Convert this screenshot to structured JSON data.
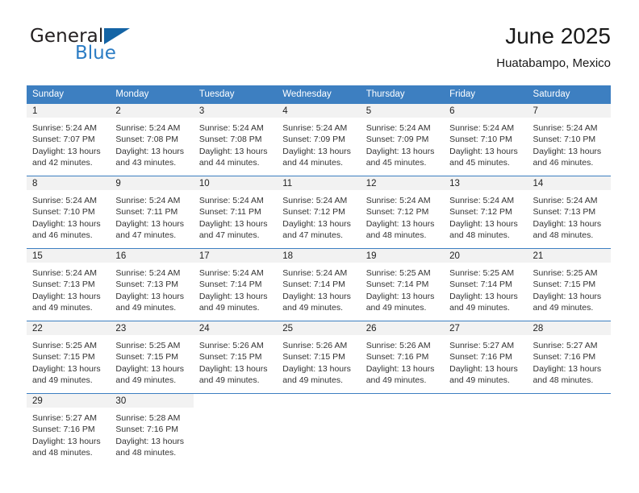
{
  "brand": {
    "name_top": "General",
    "name_bottom": "Blue",
    "flag_icon": "brand-flag-icon"
  },
  "header": {
    "title": "June 2025",
    "subtitle": "Huatabampo, Mexico"
  },
  "calendar": {
    "weekday_headers": [
      "Sunday",
      "Monday",
      "Tuesday",
      "Wednesday",
      "Thursday",
      "Friday",
      "Saturday"
    ],
    "colors": {
      "header_blue": "#3d7fc1",
      "daynum_band": "#f2f2f2",
      "brand_blue": "#2b7cc4",
      "flag_blue": "#1464a5"
    },
    "weeks": [
      [
        {
          "day": "1",
          "sunrise": "Sunrise: 5:24 AM",
          "sunset": "Sunset: 7:07 PM",
          "daylight_1": "Daylight: 13 hours",
          "daylight_2": "and 42 minutes."
        },
        {
          "day": "2",
          "sunrise": "Sunrise: 5:24 AM",
          "sunset": "Sunset: 7:08 PM",
          "daylight_1": "Daylight: 13 hours",
          "daylight_2": "and 43 minutes."
        },
        {
          "day": "3",
          "sunrise": "Sunrise: 5:24 AM",
          "sunset": "Sunset: 7:08 PM",
          "daylight_1": "Daylight: 13 hours",
          "daylight_2": "and 44 minutes."
        },
        {
          "day": "4",
          "sunrise": "Sunrise: 5:24 AM",
          "sunset": "Sunset: 7:09 PM",
          "daylight_1": "Daylight: 13 hours",
          "daylight_2": "and 44 minutes."
        },
        {
          "day": "5",
          "sunrise": "Sunrise: 5:24 AM",
          "sunset": "Sunset: 7:09 PM",
          "daylight_1": "Daylight: 13 hours",
          "daylight_2": "and 45 minutes."
        },
        {
          "day": "6",
          "sunrise": "Sunrise: 5:24 AM",
          "sunset": "Sunset: 7:10 PM",
          "daylight_1": "Daylight: 13 hours",
          "daylight_2": "and 45 minutes."
        },
        {
          "day": "7",
          "sunrise": "Sunrise: 5:24 AM",
          "sunset": "Sunset: 7:10 PM",
          "daylight_1": "Daylight: 13 hours",
          "daylight_2": "and 46 minutes."
        }
      ],
      [
        {
          "day": "8",
          "sunrise": "Sunrise: 5:24 AM",
          "sunset": "Sunset: 7:10 PM",
          "daylight_1": "Daylight: 13 hours",
          "daylight_2": "and 46 minutes."
        },
        {
          "day": "9",
          "sunrise": "Sunrise: 5:24 AM",
          "sunset": "Sunset: 7:11 PM",
          "daylight_1": "Daylight: 13 hours",
          "daylight_2": "and 47 minutes."
        },
        {
          "day": "10",
          "sunrise": "Sunrise: 5:24 AM",
          "sunset": "Sunset: 7:11 PM",
          "daylight_1": "Daylight: 13 hours",
          "daylight_2": "and 47 minutes."
        },
        {
          "day": "11",
          "sunrise": "Sunrise: 5:24 AM",
          "sunset": "Sunset: 7:12 PM",
          "daylight_1": "Daylight: 13 hours",
          "daylight_2": "and 47 minutes."
        },
        {
          "day": "12",
          "sunrise": "Sunrise: 5:24 AM",
          "sunset": "Sunset: 7:12 PM",
          "daylight_1": "Daylight: 13 hours",
          "daylight_2": "and 48 minutes."
        },
        {
          "day": "13",
          "sunrise": "Sunrise: 5:24 AM",
          "sunset": "Sunset: 7:12 PM",
          "daylight_1": "Daylight: 13 hours",
          "daylight_2": "and 48 minutes."
        },
        {
          "day": "14",
          "sunrise": "Sunrise: 5:24 AM",
          "sunset": "Sunset: 7:13 PM",
          "daylight_1": "Daylight: 13 hours",
          "daylight_2": "and 48 minutes."
        }
      ],
      [
        {
          "day": "15",
          "sunrise": "Sunrise: 5:24 AM",
          "sunset": "Sunset: 7:13 PM",
          "daylight_1": "Daylight: 13 hours",
          "daylight_2": "and 49 minutes."
        },
        {
          "day": "16",
          "sunrise": "Sunrise: 5:24 AM",
          "sunset": "Sunset: 7:13 PM",
          "daylight_1": "Daylight: 13 hours",
          "daylight_2": "and 49 minutes."
        },
        {
          "day": "17",
          "sunrise": "Sunrise: 5:24 AM",
          "sunset": "Sunset: 7:14 PM",
          "daylight_1": "Daylight: 13 hours",
          "daylight_2": "and 49 minutes."
        },
        {
          "day": "18",
          "sunrise": "Sunrise: 5:24 AM",
          "sunset": "Sunset: 7:14 PM",
          "daylight_1": "Daylight: 13 hours",
          "daylight_2": "and 49 minutes."
        },
        {
          "day": "19",
          "sunrise": "Sunrise: 5:25 AM",
          "sunset": "Sunset: 7:14 PM",
          "daylight_1": "Daylight: 13 hours",
          "daylight_2": "and 49 minutes."
        },
        {
          "day": "20",
          "sunrise": "Sunrise: 5:25 AM",
          "sunset": "Sunset: 7:14 PM",
          "daylight_1": "Daylight: 13 hours",
          "daylight_2": "and 49 minutes."
        },
        {
          "day": "21",
          "sunrise": "Sunrise: 5:25 AM",
          "sunset": "Sunset: 7:15 PM",
          "daylight_1": "Daylight: 13 hours",
          "daylight_2": "and 49 minutes."
        }
      ],
      [
        {
          "day": "22",
          "sunrise": "Sunrise: 5:25 AM",
          "sunset": "Sunset: 7:15 PM",
          "daylight_1": "Daylight: 13 hours",
          "daylight_2": "and 49 minutes."
        },
        {
          "day": "23",
          "sunrise": "Sunrise: 5:25 AM",
          "sunset": "Sunset: 7:15 PM",
          "daylight_1": "Daylight: 13 hours",
          "daylight_2": "and 49 minutes."
        },
        {
          "day": "24",
          "sunrise": "Sunrise: 5:26 AM",
          "sunset": "Sunset: 7:15 PM",
          "daylight_1": "Daylight: 13 hours",
          "daylight_2": "and 49 minutes."
        },
        {
          "day": "25",
          "sunrise": "Sunrise: 5:26 AM",
          "sunset": "Sunset: 7:15 PM",
          "daylight_1": "Daylight: 13 hours",
          "daylight_2": "and 49 minutes."
        },
        {
          "day": "26",
          "sunrise": "Sunrise: 5:26 AM",
          "sunset": "Sunset: 7:16 PM",
          "daylight_1": "Daylight: 13 hours",
          "daylight_2": "and 49 minutes."
        },
        {
          "day": "27",
          "sunrise": "Sunrise: 5:27 AM",
          "sunset": "Sunset: 7:16 PM",
          "daylight_1": "Daylight: 13 hours",
          "daylight_2": "and 49 minutes."
        },
        {
          "day": "28",
          "sunrise": "Sunrise: 5:27 AM",
          "sunset": "Sunset: 7:16 PM",
          "daylight_1": "Daylight: 13 hours",
          "daylight_2": "and 48 minutes."
        }
      ],
      [
        {
          "day": "29",
          "sunrise": "Sunrise: 5:27 AM",
          "sunset": "Sunset: 7:16 PM",
          "daylight_1": "Daylight: 13 hours",
          "daylight_2": "and 48 minutes."
        },
        {
          "day": "30",
          "sunrise": "Sunrise: 5:28 AM",
          "sunset": "Sunset: 7:16 PM",
          "daylight_1": "Daylight: 13 hours",
          "daylight_2": "and 48 minutes."
        },
        null,
        null,
        null,
        null,
        null
      ]
    ]
  }
}
